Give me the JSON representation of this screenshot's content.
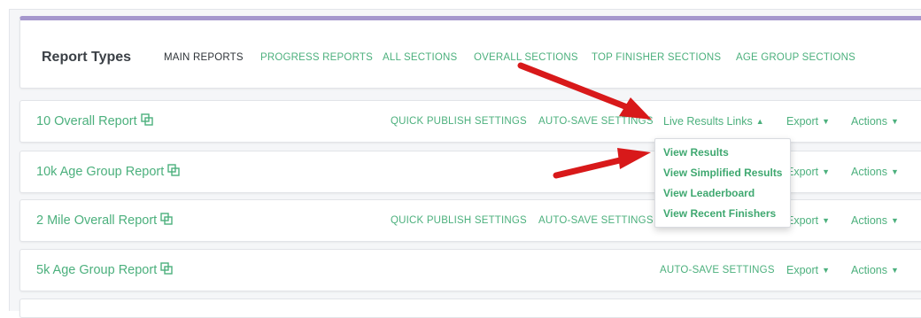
{
  "report_types": {
    "title": "Report Types",
    "tabs": [
      {
        "label": "MAIN REPORTS",
        "active": true
      },
      {
        "label": "PROGRESS REPORTS",
        "active": false
      },
      {
        "label": "ALL SECTIONS",
        "active": false
      },
      {
        "label": "OVERALL SECTIONS",
        "active": false
      },
      {
        "label": "TOP FINISHER SECTIONS",
        "active": false
      },
      {
        "label": "AGE GROUP SECTIONS",
        "active": false
      }
    ]
  },
  "reports": [
    {
      "name": "10 Overall Report",
      "quick_publish": "QUICK PUBLISH SETTINGS",
      "auto_save": "AUTO-SAVE SETTINGS",
      "live_results": "Live Results Links",
      "export": "Export",
      "actions": "Actions"
    },
    {
      "name": "10k Age Group Report",
      "export": "Export",
      "actions": "Actions"
    },
    {
      "name": "2 Mile Overall Report",
      "quick_publish": "QUICK PUBLISH SETTINGS",
      "auto_save": "AUTO-SAVE SETTINGS",
      "export": "Export",
      "actions": "Actions"
    },
    {
      "name": "5k Age Group Report",
      "auto_save": "AUTO-SAVE SETTINGS",
      "export": "Export",
      "actions": "Actions"
    }
  ],
  "live_results_menu": {
    "items": [
      "View Results",
      "View Simplified Results",
      "View Leaderboard",
      "View Recent Finishers"
    ]
  },
  "icons": {
    "copy": "copy-icon",
    "caret_up": "caret-up-icon",
    "caret_down": "caret-down-icon"
  },
  "colors": {
    "accent_green": "#4cb07d",
    "header_border": "#a597cd",
    "annotation_arrow": "#d8191a"
  }
}
